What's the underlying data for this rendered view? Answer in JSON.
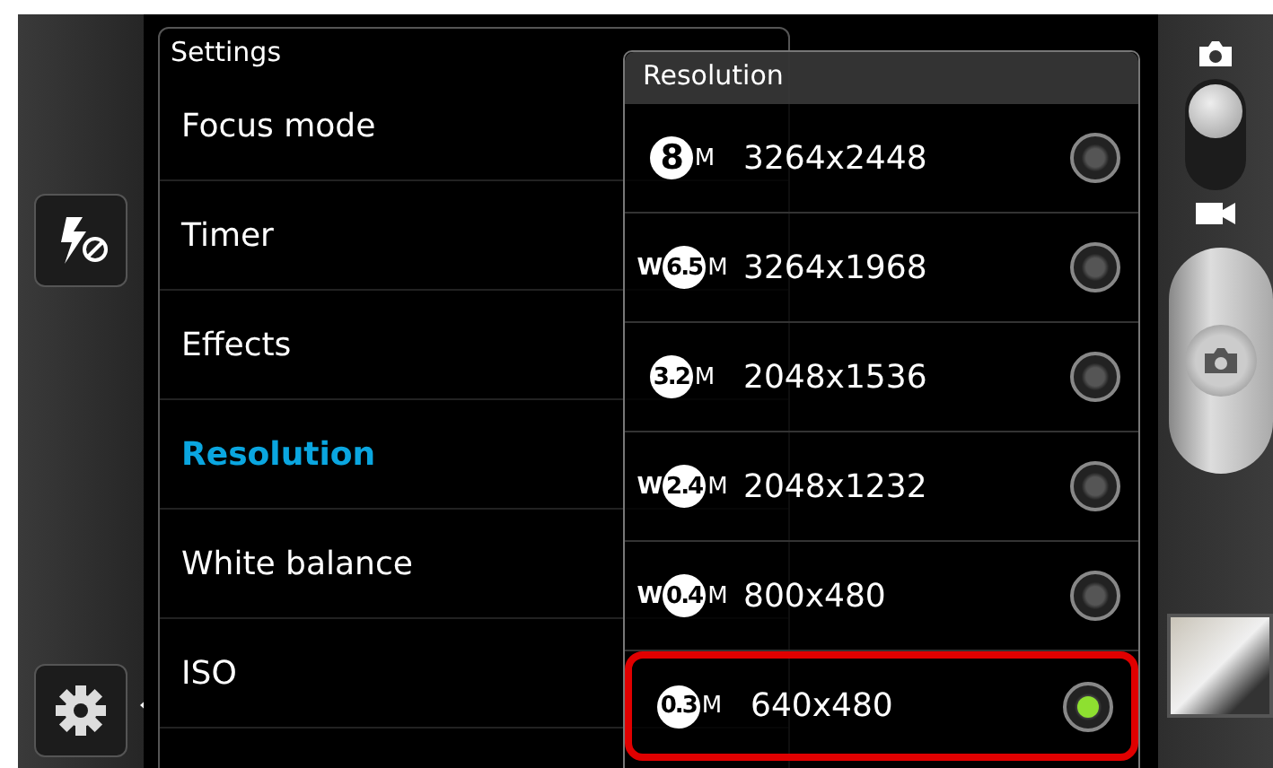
{
  "settings": {
    "title": "Settings",
    "items": [
      {
        "label": "Focus mode",
        "selected": false
      },
      {
        "label": "Timer",
        "selected": false
      },
      {
        "label": "Effects",
        "selected": false
      },
      {
        "label": "Resolution",
        "selected": true
      },
      {
        "label": "White balance",
        "selected": false
      },
      {
        "label": "ISO",
        "selected": false
      }
    ]
  },
  "resolution_popup": {
    "title": "Resolution",
    "options": [
      {
        "megapixels": "8",
        "unit": "M",
        "size": "3264x2448",
        "selected": false,
        "highlighted": false
      },
      {
        "prefix": "W",
        "megapixels": "6.5",
        "unit": "M",
        "size": "3264x1968",
        "selected": false,
        "highlighted": false
      },
      {
        "megapixels": "3.2",
        "unit": "M",
        "size": "2048x1536",
        "selected": false,
        "highlighted": false
      },
      {
        "prefix": "W",
        "megapixels": "2.4",
        "unit": "M",
        "size": "2048x1232",
        "selected": false,
        "highlighted": false
      },
      {
        "prefix": "W",
        "megapixels": "0.4",
        "unit": "M",
        "size": "800x480",
        "selected": false,
        "highlighted": false
      },
      {
        "megapixels": "0.3",
        "unit": "M",
        "size": "640x480",
        "selected": true,
        "highlighted": true
      }
    ]
  },
  "mode_switch": {
    "photo_selected": true
  }
}
